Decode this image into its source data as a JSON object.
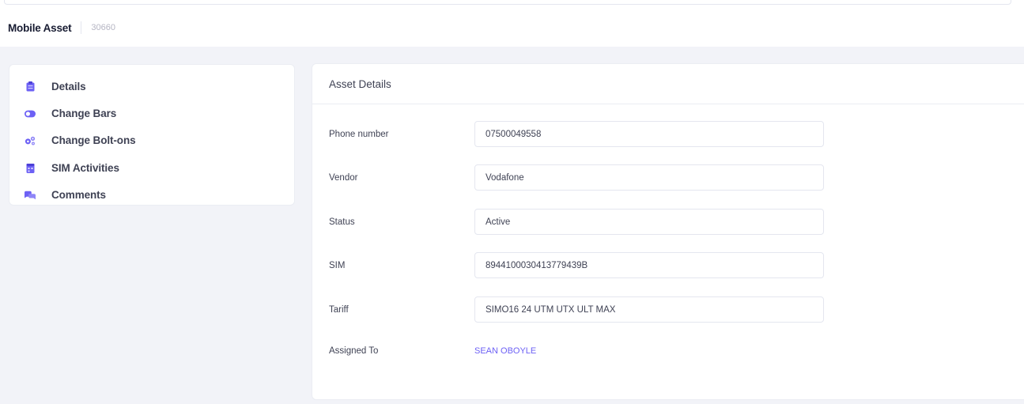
{
  "header": {
    "title": "Mobile Asset",
    "asset_id": "30660"
  },
  "sidebar": {
    "items": [
      {
        "label": "Details",
        "icon": "clipboard-icon"
      },
      {
        "label": "Change Bars",
        "icon": "toggle-icon"
      },
      {
        "label": "Change Bolt-ons",
        "icon": "gears-icon"
      },
      {
        "label": "SIM Activities",
        "icon": "calendar-icon"
      },
      {
        "label": "Comments",
        "icon": "chat-icon"
      }
    ]
  },
  "card": {
    "title": "Asset Details",
    "fields": {
      "phone": {
        "label": "Phone number",
        "value": "07500049558"
      },
      "vendor": {
        "label": "Vendor",
        "value": "Vodafone"
      },
      "status": {
        "label": "Status",
        "value": "Active"
      },
      "sim": {
        "label": "SIM",
        "value": "8944100030413779439B"
      },
      "tariff": {
        "label": "Tariff",
        "value": "SIMO16 24 UTM UTX ULT MAX"
      },
      "assigned": {
        "label": "Assigned To",
        "value": "SEAN OBOYLE"
      }
    }
  },
  "colors": {
    "accent": "#6d61f5",
    "background": "#f2f3f8",
    "card": "#ffffff",
    "text": "#3f4254"
  }
}
